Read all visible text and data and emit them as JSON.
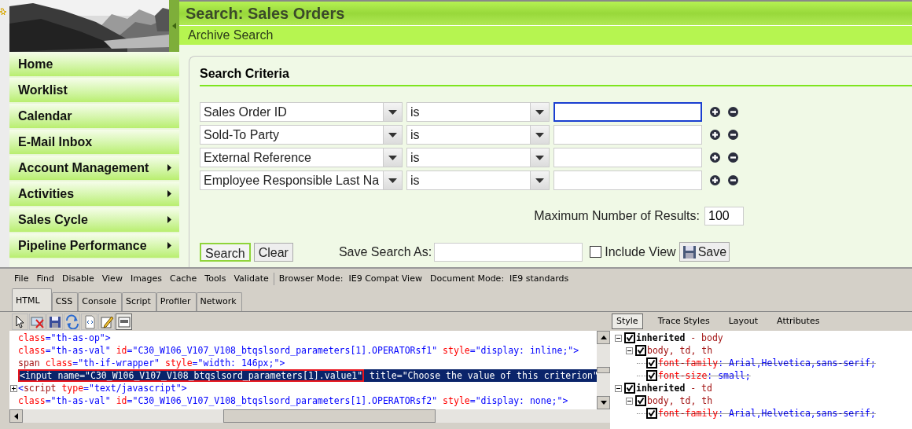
{
  "sidebar": {
    "items": [
      {
        "label": "Home",
        "submenu": false
      },
      {
        "label": "Worklist",
        "submenu": false
      },
      {
        "label": "Calendar",
        "submenu": false
      },
      {
        "label": "E-Mail Inbox",
        "submenu": false
      },
      {
        "label": "Account Management",
        "submenu": true
      },
      {
        "label": "Activities",
        "submenu": true
      },
      {
        "label": "Sales Cycle",
        "submenu": true
      },
      {
        "label": "Pipeline Performance",
        "submenu": true
      }
    ]
  },
  "page": {
    "title": "Search: Sales Orders",
    "subtitle": "Archive Search"
  },
  "search_criteria": {
    "title": "Search Criteria",
    "rows": [
      {
        "field": "Sales Order ID",
        "operator": "is",
        "focused": true
      },
      {
        "field": "Sold-To Party",
        "operator": "is",
        "focused": false
      },
      {
        "field": "External Reference",
        "operator": "is",
        "focused": false
      },
      {
        "field": "Employee Responsible Last Na",
        "operator": "is",
        "focused": false
      }
    ],
    "max_results": {
      "label": "Maximum Number of Results:",
      "value": "100"
    },
    "search_button": "Search",
    "clear_button": "Clear",
    "save_as_label": "Save Search As:",
    "include_view": {
      "label": "Include View",
      "checked": false
    },
    "save_button": "Save"
  },
  "devtools": {
    "menu": [
      "File",
      "Find",
      "Disable",
      "View",
      "Images",
      "Cache",
      "Tools",
      "Validate"
    ],
    "browser_mode": "Browser Mode:  IE9 Compat View",
    "document_mode": "Document Mode:  IE9 standards",
    "tabs": [
      {
        "label": "HTML",
        "selected": true
      },
      {
        "label": "CSS",
        "selected": false
      },
      {
        "label": "Console",
        "selected": false
      },
      {
        "label": "Script",
        "selected": false
      },
      {
        "label": "Profiler",
        "selected": false
      },
      {
        "label": "Network",
        "selected": false
      }
    ],
    "toolbar": [
      {
        "kind": "pointer",
        "pressed": false
      },
      {
        "kind": "clear",
        "pressed": false
      },
      {
        "kind": "save",
        "pressed": false
      },
      {
        "kind": "refresh",
        "pressed": false
      },
      {
        "kind": "source",
        "pressed": false
      },
      {
        "kind": "edit",
        "pressed": false
      },
      {
        "kind": "wrap",
        "pressed": true
      }
    ],
    "code_lines": [
      {
        "highlighted": false,
        "expander": false,
        "tokens": [
          {
            "kind": "attr",
            "text": "class"
          },
          {
            "kind": "punct",
            "text": "="
          },
          {
            "kind": "value",
            "text": "\"th-as-op\""
          },
          {
            "kind": "punct",
            "text": ">"
          }
        ]
      },
      {
        "highlighted": false,
        "expander": false,
        "tokens": [
          {
            "kind": "attr",
            "text": "class"
          },
          {
            "kind": "punct",
            "text": "="
          },
          {
            "kind": "value",
            "text": "\"th-as-val\""
          },
          {
            "kind": "attr",
            "text": " id"
          },
          {
            "kind": "punct",
            "text": "="
          },
          {
            "kind": "value",
            "text": "\"C30_W106_V107_V108_btqslsord_parameters[1].OPERATORsf1\""
          },
          {
            "kind": "attr",
            "text": " style"
          },
          {
            "kind": "punct",
            "text": "="
          },
          {
            "kind": "value",
            "text": "\"display: inline;\""
          },
          {
            "kind": "punct",
            "text": ">"
          }
        ]
      },
      {
        "highlighted": false,
        "expander": false,
        "tokens": [
          {
            "kind": "tag",
            "text": "span"
          },
          {
            "kind": "attr",
            "text": " class"
          },
          {
            "kind": "punct",
            "text": "="
          },
          {
            "kind": "value",
            "text": "\"th-if-wrapper\""
          },
          {
            "kind": "attr",
            "text": " style"
          },
          {
            "kind": "punct",
            "text": "="
          },
          {
            "kind": "value",
            "text": "\"width: 146px;\""
          },
          {
            "kind": "punct",
            "text": ">"
          }
        ]
      },
      {
        "highlighted": true,
        "expander": false,
        "tokens": [
          {
            "kind": "boxed",
            "text": "<input name=\"C30_W106_V107_V108_btqslsord_parameters[1].value1\""
          },
          {
            "kind": "plain",
            "text": " title=\"Choose the value of this criterion\""
          }
        ]
      },
      {
        "highlighted": false,
        "expander": true,
        "tokens": [
          {
            "kind": "punct",
            "text": "<"
          },
          {
            "kind": "tag",
            "text": "script"
          },
          {
            "kind": "attr",
            "text": " type"
          },
          {
            "kind": "punct",
            "text": "="
          },
          {
            "kind": "value",
            "text": "\"text/javascript\""
          },
          {
            "kind": "punct",
            "text": ">"
          }
        ]
      },
      {
        "highlighted": false,
        "expander": false,
        "tokens": [
          {
            "kind": "attr",
            "text": "class"
          },
          {
            "kind": "punct",
            "text": "="
          },
          {
            "kind": "value",
            "text": "\"th-as-val\""
          },
          {
            "kind": "attr",
            "text": " id"
          },
          {
            "kind": "punct",
            "text": "="
          },
          {
            "kind": "value",
            "text": "\"C30_W106_V107_V108_btqslsord_parameters[1].OPERATORsf2\""
          },
          {
            "kind": "attr",
            "text": " style"
          },
          {
            "kind": "punct",
            "text": "="
          },
          {
            "kind": "value",
            "text": "\"display: none;\""
          },
          {
            "kind": "punct",
            "text": ">"
          }
        ]
      }
    ],
    "style_tabs": [
      {
        "label": "Style",
        "selected": true
      },
      {
        "label": "Trace Styles",
        "selected": false
      },
      {
        "label": "Layout",
        "selected": false
      },
      {
        "label": "Attributes",
        "selected": false
      }
    ],
    "style_tree": [
      {
        "kind": "group",
        "label": "inherited",
        "selector": " - body",
        "checked": true,
        "expanded": true,
        "children": [
          {
            "kind": "rule",
            "selector": "body, td, th",
            "checked": true,
            "expanded": true,
            "children": [
              {
                "kind": "property",
                "name": "font-family",
                "value": ": Arial,Helvetica,sans-serif;",
                "checked": true,
                "overridden": true
              },
              {
                "kind": "property",
                "name": "font-size",
                "value": ": small;",
                "checked": true,
                "overridden": true
              }
            ]
          }
        ]
      },
      {
        "kind": "group",
        "label": "inherited",
        "selector": " - td",
        "checked": true,
        "expanded": true,
        "children": [
          {
            "kind": "rule",
            "selector": "body, td, th",
            "checked": true,
            "expanded": true,
            "children": [
              {
                "kind": "property",
                "name": "font-family",
                "value": ": Arial,Helvetica,sans-serif;",
                "checked": true,
                "overridden": true
              }
            ]
          }
        ]
      }
    ]
  }
}
